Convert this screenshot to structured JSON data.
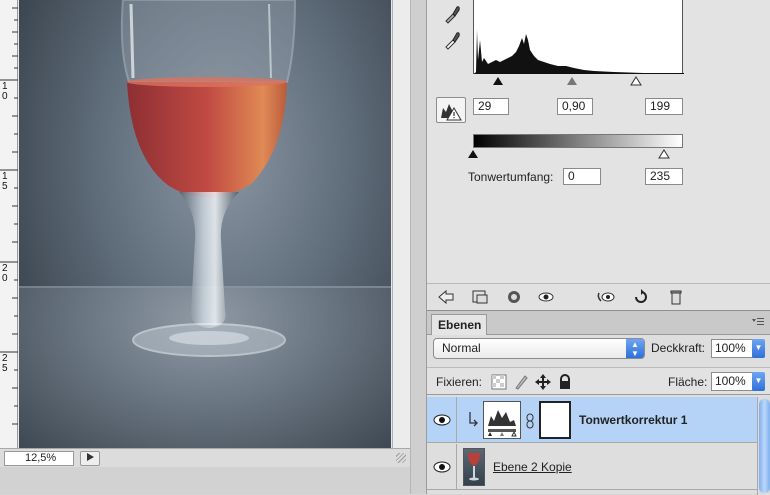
{
  "document": {
    "ruler_labels": [
      "1",
      "0",
      "1",
      "5",
      "2",
      "0",
      "2",
      "5"
    ],
    "zoom": "12,5%"
  },
  "levels": {
    "input_black": "29",
    "input_gamma": "0,90",
    "input_white": "199",
    "output_label": "Tonwertumfang:",
    "output_black": "0",
    "output_white": "235"
  },
  "layers": {
    "tab_label": "Ebenen",
    "blend_mode": "Normal",
    "opacity_label": "Deckkraft:",
    "opacity_value": "100%",
    "lock_label": "Fixieren:",
    "fill_label": "Fläche:",
    "fill_value": "100%",
    "items": [
      {
        "name": "Tonwertkorrektur 1",
        "selected": true
      },
      {
        "name": "Ebene 2 Kopie",
        "selected": false
      }
    ]
  },
  "colors": {
    "selection": "#b5d3f7",
    "wine": "#b8403a",
    "accent": "#2e6fd9"
  }
}
